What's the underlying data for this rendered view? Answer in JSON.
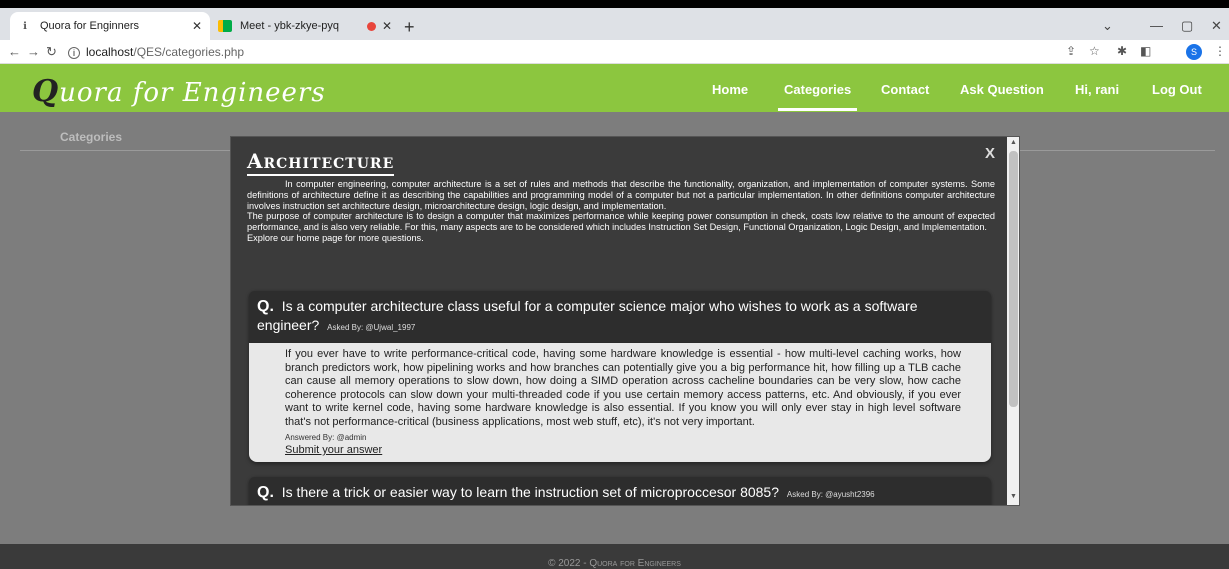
{
  "browser": {
    "tabs": [
      {
        "title": "Quora for Enginners",
        "favicon": "info-icon"
      },
      {
        "title": "Meet - ybk-zkye-pyq",
        "favicon": "meet-icon"
      }
    ],
    "url_host": "localhost",
    "url_path": "/QES/categories.php",
    "profile_initial": "S"
  },
  "header": {
    "brand_initial": "Q",
    "brand_rest": "uora for Engineers",
    "nav": [
      "Home",
      "Categories",
      "Contact",
      "Ask Question",
      "Hi, rani",
      "Log Out"
    ],
    "active_nav": "Categories",
    "colors": {
      "accent": "#8cc63f"
    }
  },
  "page": {
    "section_title": "Categories",
    "footer": "© 2022 - Quora for Engineers"
  },
  "modal": {
    "title": "Architecture",
    "close_label": "X",
    "description": [
      "In computer engineering, computer architecture is a set of rules and methods that describe the functionality, organization, and implementation of computer systems. Some definitions of architecture define it as describing the capabilities and programming model of a computer but not a particular implementation. In other definitions computer architecture involves instruction set architecture design, microarchitecture design, logic design, and implementation.",
      "The purpose of computer architecture is to design a computer that maximizes performance while keeping power consumption in check, costs low relative to the amount of expected performance, and is also very reliable. For this, many aspects are to be considered which includes Instruction Set Design, Functional Organization, Logic Design, and Implementation.",
      "Explore our home page for more questions."
    ],
    "questions": [
      {
        "q_mark": "Q.",
        "text": "Is a computer architecture class useful for a computer science major who wishes to work as a software engineer?",
        "asked_by": "Asked By: @Ujwal_1997",
        "answer": "If you ever have to write performance-critical code, having some hardware knowledge is essential - how multi-level caching works, how branch predictors work, how pipelining works and how branches can potentially give you a big performance hit, how filling up a TLB cache can cause all memory operations to slow down, how doing a SIMD operation across cacheline boundaries can be very slow, how cache coherence protocols can slow down your multi-threaded code if you use certain memory access patterns, etc. And obviously, if you ever want to write kernel code, having some hardware knowledge is also essential. If you know you will only ever stay in high level software that's not performance-critical (business applications, most web stuff, etc), it's not very important.",
        "answered_by": "Answered By: @admin",
        "submit_label": "Submit your answer"
      },
      {
        "q_mark": "Q.",
        "text": "Is there a trick or easier way to learn the instruction set of microproccesor 8085?",
        "asked_by": "Asked By: @ayusht2396"
      }
    ]
  }
}
